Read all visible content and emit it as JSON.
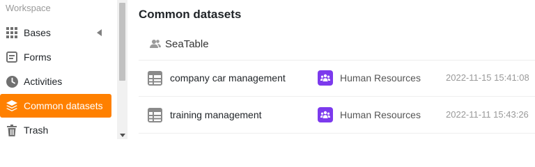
{
  "sidebar": {
    "workspace_title": "Workspace",
    "items": [
      {
        "label": "Bases",
        "icon": "grid-icon"
      },
      {
        "label": "Forms",
        "icon": "form-icon"
      },
      {
        "label": "Activities",
        "icon": "clock-icon"
      },
      {
        "label": "Common datasets",
        "icon": "layers-icon",
        "active": true
      },
      {
        "label": "Trash",
        "icon": "trash-icon"
      }
    ]
  },
  "main": {
    "title": "Common datasets",
    "group": {
      "label": "SeaTable",
      "icon": "users-icon"
    },
    "rows": [
      {
        "name": "company car management",
        "department": "Human Resources",
        "timestamp": "2022-11-15 15:41:08"
      },
      {
        "name": "training management",
        "department": "Human Resources",
        "timestamp": "2022-11-11 15:43:26"
      }
    ]
  },
  "colors": {
    "accent": "#ff8000",
    "department_badge": "#7c3aed",
    "muted_text": "#999999"
  }
}
